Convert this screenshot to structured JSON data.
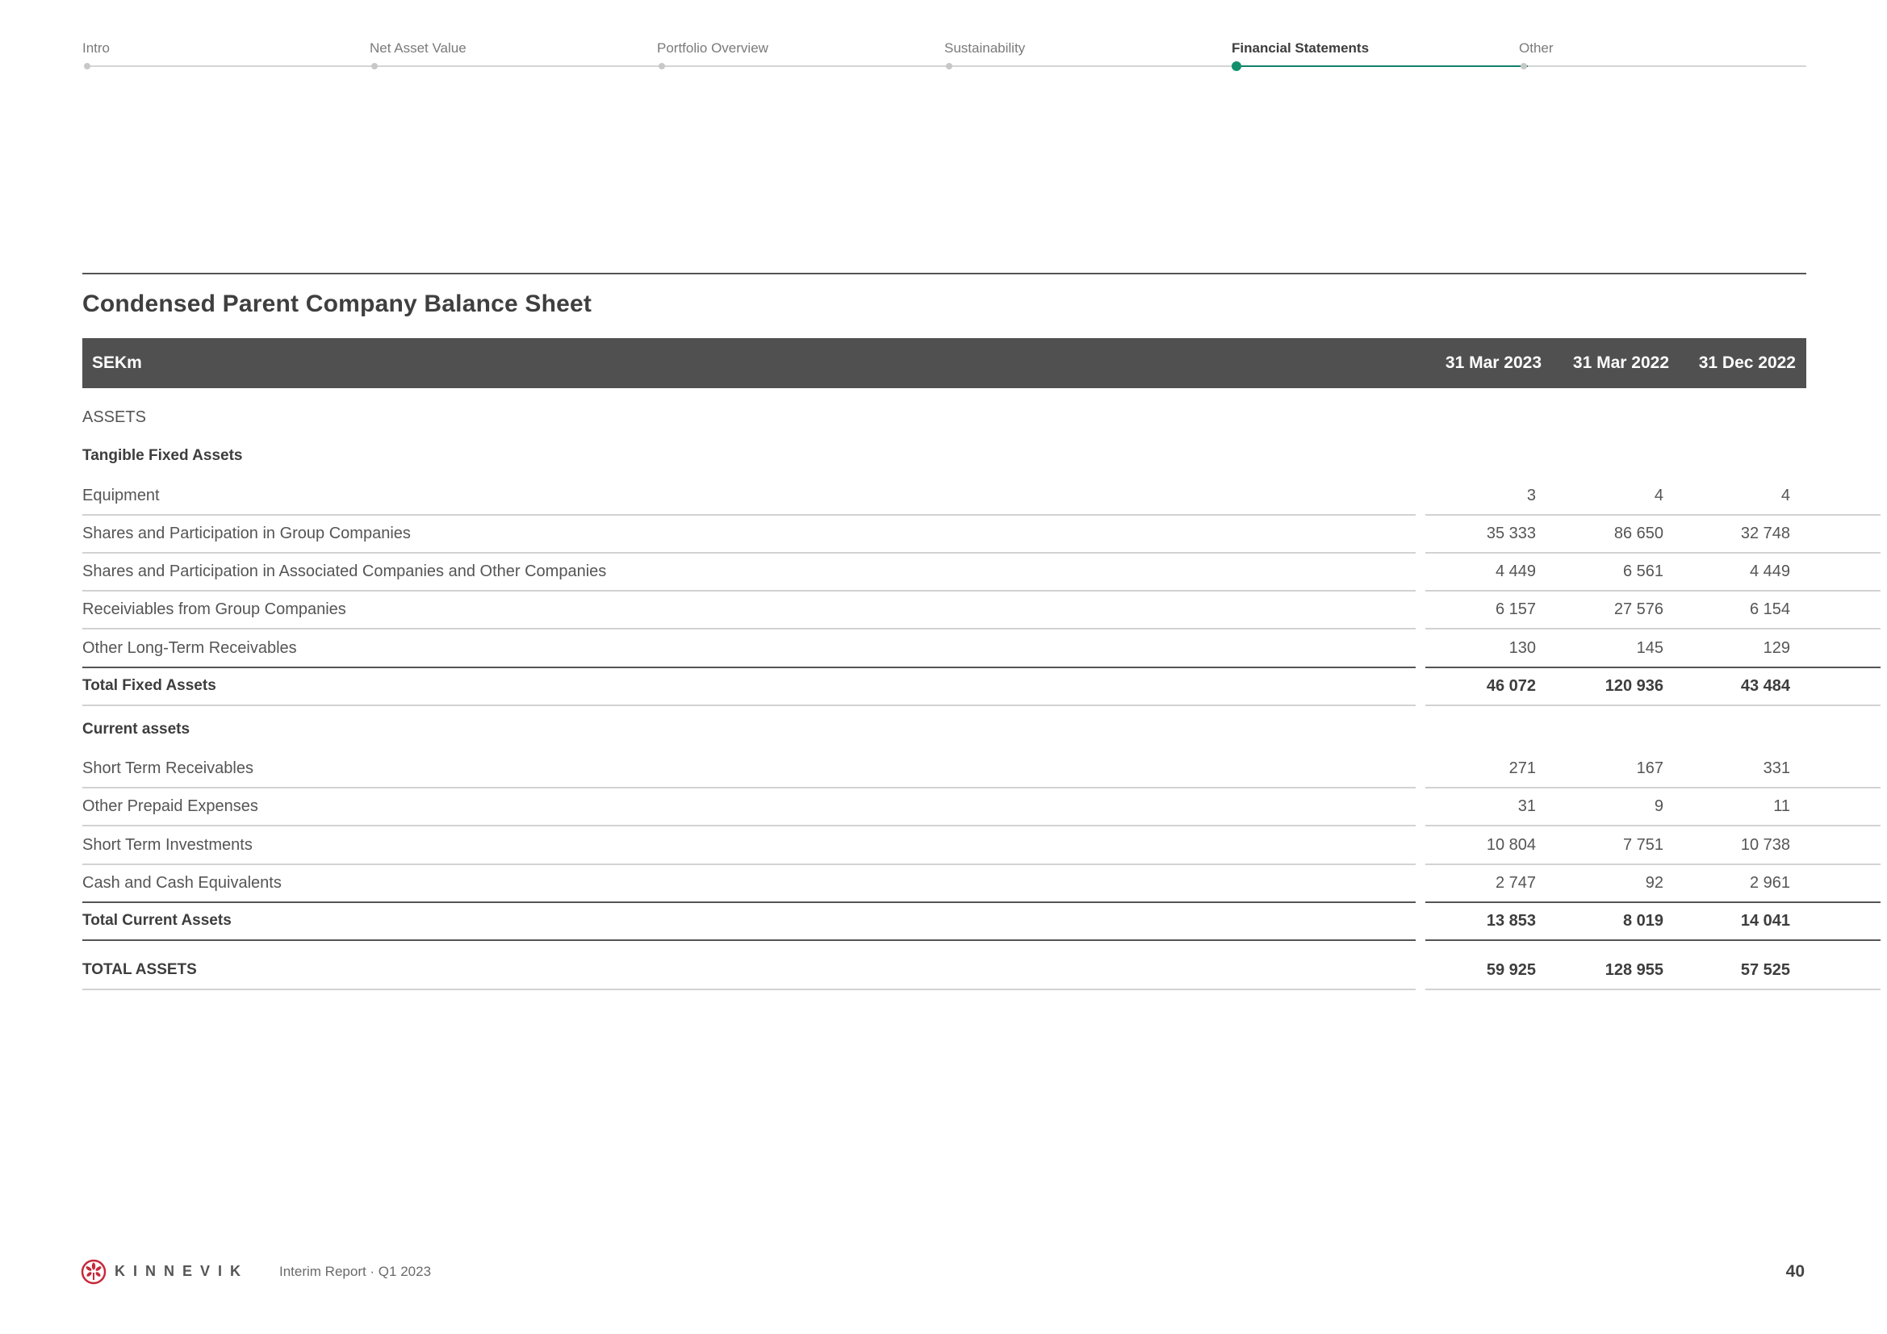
{
  "nav": {
    "items": [
      {
        "label": "Intro",
        "active": false
      },
      {
        "label": "Net Asset Value",
        "active": false
      },
      {
        "label": "Portfolio Overview",
        "active": false
      },
      {
        "label": "Sustainability",
        "active": false
      },
      {
        "label": "Financial Statements",
        "active": true
      },
      {
        "label": "Other",
        "active": false
      }
    ],
    "accent_color": "#12906e"
  },
  "title": "Condensed Parent Company Balance Sheet",
  "table": {
    "unit": "SEKm",
    "columns": [
      "31 Mar 2023",
      "31 Mar 2022",
      "31 Dec 2022"
    ],
    "section": "ASSETS",
    "groups": [
      {
        "label": "Tangible Fixed Assets",
        "rows": [
          {
            "label": "Equipment",
            "values": [
              "3",
              "4",
              "4"
            ]
          },
          {
            "label": "Shares and Participation in Group Companies",
            "values": [
              "35 333",
              "86 650",
              "32 748"
            ]
          },
          {
            "label": "Shares and Participation in Associated Companies and Other Companies",
            "values": [
              "4 449",
              "6 561",
              "4 449"
            ]
          },
          {
            "label": "Receiviables from Group Companies",
            "values": [
              "6 157",
              "27 576",
              "6 154"
            ]
          },
          {
            "label": "Other Long-Term Receivables",
            "values": [
              "130",
              "145",
              "129"
            ]
          }
        ],
        "total": {
          "label": "Total Fixed Assets",
          "values": [
            "46 072",
            "120 936",
            "43 484"
          ]
        }
      },
      {
        "label": "Current assets",
        "rows": [
          {
            "label": "Short Term Receivables",
            "values": [
              "271",
              "167",
              "331"
            ]
          },
          {
            "label": "Other Prepaid Expenses",
            "values": [
              "31",
              "9",
              "11"
            ]
          },
          {
            "label": "Short Term Investments",
            "values": [
              "10 804",
              "7 751",
              "10 738"
            ]
          },
          {
            "label": "Cash and Cash Equivalents",
            "values": [
              "2 747",
              "92",
              "2 961"
            ]
          }
        ],
        "total": {
          "label": "Total Current Assets",
          "values": [
            "13 853",
            "8 019",
            "14 041"
          ]
        }
      }
    ],
    "grand_total": {
      "label": "TOTAL ASSETS",
      "values": [
        "59 925",
        "128 955",
        "57 525"
      ]
    }
  },
  "footer": {
    "logo_icon": "kinnevik-logo-icon",
    "brand": "KINNEVIK",
    "report": "Interim Report · Q1 2023",
    "page": "40"
  }
}
